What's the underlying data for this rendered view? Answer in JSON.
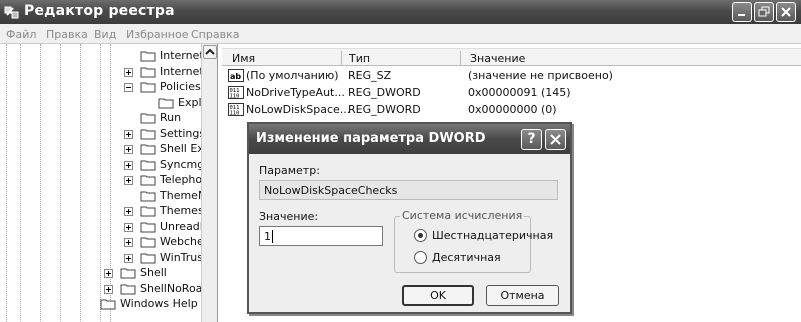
{
  "window": {
    "title": "Редактор реестра"
  },
  "menu": [
    "Файл",
    "Правка",
    "Вид",
    "Избранное",
    "Справка"
  ],
  "tree": {
    "items": [
      {
        "label": "Internet",
        "expander": "none"
      },
      {
        "label": "Internet",
        "expander": "plus"
      },
      {
        "label": "Policies",
        "expander": "minus"
      },
      {
        "label": "Expl",
        "expander": "none",
        "child": true
      },
      {
        "label": "Run",
        "expander": "none"
      },
      {
        "label": "Settings",
        "expander": "plus"
      },
      {
        "label": "Shell Ext",
        "expander": "plus"
      },
      {
        "label": "Syncmgr",
        "expander": "plus"
      },
      {
        "label": "Telepho",
        "expander": "plus"
      },
      {
        "label": "ThemeM",
        "expander": "none"
      },
      {
        "label": "Themes",
        "expander": "plus"
      },
      {
        "label": "UnreadM",
        "expander": "plus"
      },
      {
        "label": "Webche",
        "expander": "plus"
      },
      {
        "label": "WinTrus",
        "expander": "plus"
      },
      {
        "label": "Shell",
        "expander": "plus",
        "level": 0
      },
      {
        "label": "ShellNoRoar",
        "expander": "plus",
        "level": 0
      },
      {
        "label": "Windows Help",
        "expander": "none",
        "level": -1
      }
    ]
  },
  "list": {
    "columns": [
      "Имя",
      "Тип",
      "Значение"
    ],
    "rows": [
      {
        "icon": "string-value-icon",
        "name": "(По умолчанию)",
        "type": "REG_SZ",
        "value": "(значение не присвоено)"
      },
      {
        "icon": "dword-value-icon",
        "name": "NoDriveTypeAut...",
        "type": "REG_DWORD",
        "value": "0x00000091 (145)"
      },
      {
        "icon": "dword-value-icon",
        "name": "NoLowDiskSpace...",
        "type": "REG_DWORD",
        "value": "0x00000000 (0)"
      }
    ]
  },
  "dialog": {
    "title": "Изменение параметра DWORD",
    "help": "?",
    "param_label": "Параметр:",
    "param_value": "NoLowDiskSpaceChecks",
    "value_label": "Значение:",
    "value": "1",
    "base_title": "Система исчисления",
    "hex_label": "Шестнадцатеричная",
    "dec_label": "Десятичная",
    "selected_base": "hex",
    "ok": "OK",
    "cancel": "Отмена"
  }
}
